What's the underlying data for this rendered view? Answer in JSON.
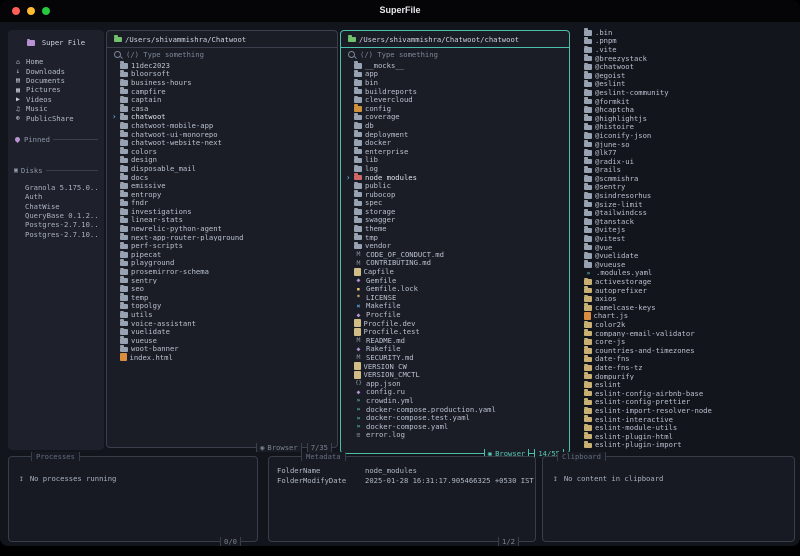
{
  "window": {
    "title": "SuperFile"
  },
  "colors": {
    "accent_teal": "#4cbfab",
    "border_gray": "#3b404e",
    "app_bg": "#13151c",
    "panel_bg": "#1a1d26",
    "sidebar_bg": "#1e212b",
    "selected_arrow": "#58a7f0",
    "folder_gray": "#99a2b3",
    "folder_red": "#cf6767",
    "folder_orange": "#cf913c",
    "folder_tan": "#c9af72",
    "folder_green": "#72bf6d",
    "folder_purple": "#b893d4",
    "file_beige": "#d2bd86",
    "traffic_red": "#ff5f57",
    "traffic_yellow": "#febc2e",
    "traffic_green": "#28c840"
  },
  "icons": {
    "select_arrow": "›",
    "browser_mode": "◉",
    "tray": "↧",
    "disks": "▣"
  },
  "sidebar": {
    "title": "Super File",
    "items": [
      {
        "icon": "home-icon",
        "glyph": "⌂",
        "label": "Home"
      },
      {
        "icon": "downloads-icon",
        "glyph": "↓",
        "label": "Downloads"
      },
      {
        "icon": "documents-icon",
        "glyph": "▤",
        "label": "Documents"
      },
      {
        "icon": "pictures-icon",
        "glyph": "▦",
        "label": "Pictures"
      },
      {
        "icon": "videos-icon",
        "glyph": "▶",
        "label": "Videos"
      },
      {
        "icon": "music-icon",
        "glyph": "♫",
        "label": "Music"
      },
      {
        "icon": "publicshare-icon",
        "glyph": "⊕",
        "label": "PublicShare"
      }
    ],
    "pinned_label": "Pinned",
    "disks_label": "Disks",
    "disks": [
      "Granola 5.175.0...",
      "Auth",
      "ChatWise",
      "QueryBase 0.1.2...",
      "Postgres-2.7.10...",
      "Postgres-2.7.10..."
    ]
  },
  "panels": [
    {
      "path": "/Users/shivammishra/Chatwoot",
      "search_placeholder": "(/) Type something",
      "mode": "Browser",
      "count": "7/35",
      "files": [
        {
          "n": "11dec2023",
          "t": "d"
        },
        {
          "n": "bloorsoft",
          "t": "d"
        },
        {
          "n": "business-hours",
          "t": "d"
        },
        {
          "n": "campfire",
          "t": "d"
        },
        {
          "n": "captain",
          "t": "d"
        },
        {
          "n": "casa",
          "t": "d"
        },
        {
          "n": "chatwoot",
          "t": "d",
          "s": true
        },
        {
          "n": "chatwoot-mobile-app",
          "t": "d"
        },
        {
          "n": "chatwoot-ui-monorepo",
          "t": "d"
        },
        {
          "n": "chatwoot-website-next",
          "t": "d"
        },
        {
          "n": "colors",
          "t": "d"
        },
        {
          "n": "design",
          "t": "d"
        },
        {
          "n": "disposable_mail",
          "t": "d"
        },
        {
          "n": "docs",
          "t": "d"
        },
        {
          "n": "emissive",
          "t": "d"
        },
        {
          "n": "entropy",
          "t": "d"
        },
        {
          "n": "fndr",
          "t": "d"
        },
        {
          "n": "investigations",
          "t": "d"
        },
        {
          "n": "linear-stats",
          "t": "d"
        },
        {
          "n": "newrelic-python-agent",
          "t": "d"
        },
        {
          "n": "next-app-router-playground",
          "t": "d"
        },
        {
          "n": "perf-scripts",
          "t": "d"
        },
        {
          "n": "pipecat",
          "t": "d"
        },
        {
          "n": "playground",
          "t": "d"
        },
        {
          "n": "prosemirror-schema",
          "t": "d"
        },
        {
          "n": "sentry",
          "t": "d"
        },
        {
          "n": "seo",
          "t": "d"
        },
        {
          "n": "temp",
          "t": "d"
        },
        {
          "n": "topolgy",
          "t": "d"
        },
        {
          "n": "utils",
          "t": "d"
        },
        {
          "n": "voice-assistant",
          "t": "d"
        },
        {
          "n": "vuelidate",
          "t": "d"
        },
        {
          "n": "vueuse",
          "t": "d"
        },
        {
          "n": "woot-banner",
          "t": "d"
        },
        {
          "n": "index.html",
          "t": "forange"
        }
      ]
    },
    {
      "path": "/Users/shivammishra/Chatwoot/chatwoot",
      "search_placeholder": "(/) Type something",
      "mode": "Browser",
      "count": "14/55",
      "files": [
        {
          "n": "__mocks__",
          "t": "d"
        },
        {
          "n": "app",
          "t": "d"
        },
        {
          "n": "bin",
          "t": "d"
        },
        {
          "n": "buildreports",
          "t": "d"
        },
        {
          "n": "clevercloud",
          "t": "d"
        },
        {
          "n": "config",
          "t": "dorange"
        },
        {
          "n": "coverage",
          "t": "d"
        },
        {
          "n": "db",
          "t": "d"
        },
        {
          "n": "deployment",
          "t": "d"
        },
        {
          "n": "docker",
          "t": "d"
        },
        {
          "n": "enterprise",
          "t": "d"
        },
        {
          "n": "lib",
          "t": "d"
        },
        {
          "n": "log",
          "t": "d"
        },
        {
          "n": "node_modules",
          "t": "dred",
          "s": true
        },
        {
          "n": "public",
          "t": "d"
        },
        {
          "n": "rubocop",
          "t": "d"
        },
        {
          "n": "spec",
          "t": "d"
        },
        {
          "n": "storage",
          "t": "d"
        },
        {
          "n": "swagger",
          "t": "d"
        },
        {
          "n": "theme",
          "t": "d"
        },
        {
          "n": "tmp",
          "t": "d"
        },
        {
          "n": "vendor",
          "t": "d"
        },
        {
          "n": "CODE_OF_CONDUCT.md",
          "t": "md"
        },
        {
          "n": "CONTRIBUTING.md",
          "t": "md"
        },
        {
          "n": "Capfile",
          "t": "f"
        },
        {
          "n": "Gemfile",
          "t": "gem"
        },
        {
          "n": "Gemfile.lock",
          "t": "lock"
        },
        {
          "n": "LICENSE",
          "t": "key"
        },
        {
          "n": "Makefile",
          "t": "make"
        },
        {
          "n": "Procfile",
          "t": "gem"
        },
        {
          "n": "Procfile.dev",
          "t": "f"
        },
        {
          "n": "Procfile.test",
          "t": "f"
        },
        {
          "n": "README.md",
          "t": "md"
        },
        {
          "n": "Rakefile",
          "t": "gem"
        },
        {
          "n": "SECURITY.md",
          "t": "md"
        },
        {
          "n": "VERSION_CW",
          "t": "f"
        },
        {
          "n": "VERSION_CMCTL",
          "t": "f"
        },
        {
          "n": "app.json",
          "t": "json"
        },
        {
          "n": "config.ru",
          "t": "gem"
        },
        {
          "n": "crowdin.yml",
          "t": "yaml"
        },
        {
          "n": "docker-compose.production.yaml",
          "t": "yaml"
        },
        {
          "n": "docker-compose.test.yaml",
          "t": "yaml"
        },
        {
          "n": "docker-compose.yaml",
          "t": "yaml"
        },
        {
          "n": "error.log",
          "t": "log"
        }
      ]
    }
  ],
  "preview": {
    "files": [
      {
        "n": ".bin",
        "t": "d"
      },
      {
        "n": ".pnpm",
        "t": "d"
      },
      {
        "n": ".vite",
        "t": "d"
      },
      {
        "n": "@breezystack",
        "t": "d"
      },
      {
        "n": "@chatwoot",
        "t": "d"
      },
      {
        "n": "@egoist",
        "t": "d"
      },
      {
        "n": "@eslint",
        "t": "d"
      },
      {
        "n": "@eslint-community",
        "t": "d"
      },
      {
        "n": "@formkit",
        "t": "d"
      },
      {
        "n": "@hcaptcha",
        "t": "d"
      },
      {
        "n": "@highlightjs",
        "t": "d"
      },
      {
        "n": "@histoire",
        "t": "d"
      },
      {
        "n": "@iconify-json",
        "t": "d"
      },
      {
        "n": "@june-so",
        "t": "d"
      },
      {
        "n": "@lk77",
        "t": "d"
      },
      {
        "n": "@radix-ui",
        "t": "d"
      },
      {
        "n": "@rails",
        "t": "d"
      },
      {
        "n": "@scmmishra",
        "t": "d"
      },
      {
        "n": "@sentry",
        "t": "d"
      },
      {
        "n": "@sindresorhus",
        "t": "d"
      },
      {
        "n": "@size-limit",
        "t": "d"
      },
      {
        "n": "@tailwindcss",
        "t": "d"
      },
      {
        "n": "@tanstack",
        "t": "d"
      },
      {
        "n": "@vitejs",
        "t": "d"
      },
      {
        "n": "@vitest",
        "t": "d"
      },
      {
        "n": "@vue",
        "t": "d"
      },
      {
        "n": "@vuelidate",
        "t": "d"
      },
      {
        "n": "@vueuse",
        "t": "d"
      },
      {
        "n": ".modules.yaml",
        "t": "yaml"
      },
      {
        "n": "activestorage",
        "t": "dtan"
      },
      {
        "n": "autoprefixer",
        "t": "dtan"
      },
      {
        "n": "axios",
        "t": "dtan"
      },
      {
        "n": "camelcase-keys",
        "t": "dtan"
      },
      {
        "n": "chart.js",
        "t": "forange"
      },
      {
        "n": "color2k",
        "t": "dtan"
      },
      {
        "n": "company-email-validator",
        "t": "dtan"
      },
      {
        "n": "core-js",
        "t": "dtan"
      },
      {
        "n": "countries-and-timezones",
        "t": "dtan"
      },
      {
        "n": "date-fns",
        "t": "dtan"
      },
      {
        "n": "date-fns-tz",
        "t": "dtan"
      },
      {
        "n": "dompurify",
        "t": "dtan"
      },
      {
        "n": "eslint",
        "t": "dtan"
      },
      {
        "n": "eslint-config-airbnb-base",
        "t": "dtan"
      },
      {
        "n": "eslint-config-prettier",
        "t": "dtan"
      },
      {
        "n": "eslint-import-resolver-node",
        "t": "dtan"
      },
      {
        "n": "eslint-interactive",
        "t": "dtan"
      },
      {
        "n": "eslint-module-utils",
        "t": "dtan"
      },
      {
        "n": "eslint-plugin-html",
        "t": "dtan"
      },
      {
        "n": "eslint-plugin-import",
        "t": "dtan"
      }
    ]
  },
  "footer": {
    "processes": {
      "title": "Processes",
      "empty": "No processes running",
      "count": "0/0"
    },
    "metadata": {
      "title": "Metadata",
      "rows": [
        {
          "key": "FolderName",
          "value": "node_modules"
        },
        {
          "key": "FolderModifyDate",
          "value": "2025-01-28 16:31:17.905466325 +0530 IST"
        }
      ],
      "count": "1/2"
    },
    "clipboard": {
      "title": "Clipboard",
      "empty": "No content in clipboard"
    }
  }
}
